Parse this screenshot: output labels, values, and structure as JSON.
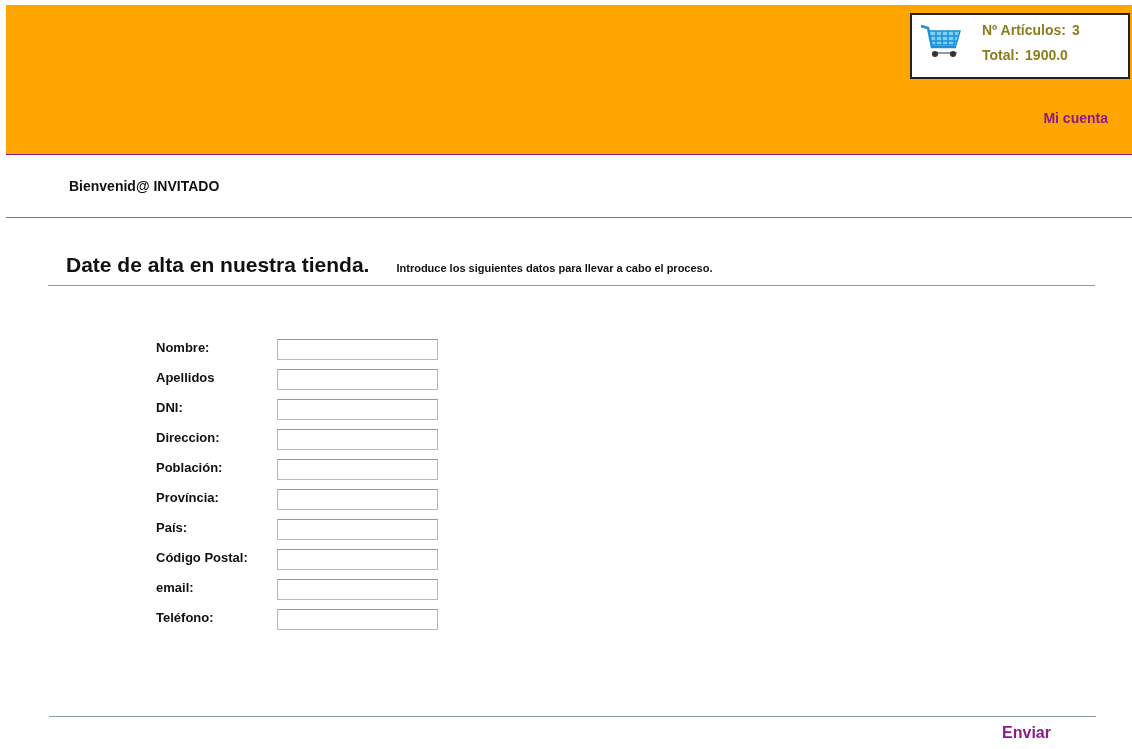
{
  "cart": {
    "items_label": "Nº Artículos:",
    "items_count": "3",
    "total_label": "Total:",
    "total": "1900.0"
  },
  "account_link": "Mi cuenta",
  "welcome": "Bienvenid@ INVITADO",
  "title": "Date de alta en nuestra tienda.",
  "subtitle": "Introduce los siguientes datos para llevar a cabo el proceso.",
  "fields": [
    {
      "label": "Nombre:"
    },
    {
      "label": "Apellidos"
    },
    {
      "label": "DNI:"
    },
    {
      "label": "Direccion:"
    },
    {
      "label": "Población:"
    },
    {
      "label": "Província:"
    },
    {
      "label": "País:"
    },
    {
      "label": "Código Postal:"
    },
    {
      "label": "email:"
    },
    {
      "label": "Teléfono:"
    }
  ],
  "submit": "Enviar"
}
